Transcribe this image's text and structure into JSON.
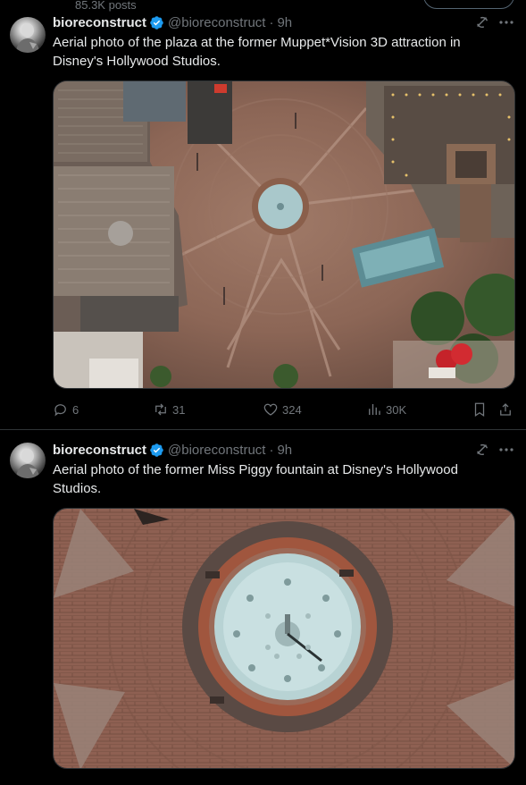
{
  "profile": {
    "posts_count": "85.3K posts"
  },
  "tweets": [
    {
      "author_name": "bioreconstruct",
      "handle": "@bioreconstruct",
      "separator": "·",
      "time": "9h",
      "text": "Aerial photo of the plaza at the former Muppet*Vision 3D attraction in Disney's Hollywood Studios.",
      "image_alt": "Aerial view of a brick plaza with a central fountain",
      "stats": {
        "replies": "6",
        "reposts": "31",
        "likes": "324",
        "views": "30K"
      }
    },
    {
      "author_name": "bioreconstruct",
      "handle": "@bioreconstruct",
      "separator": "·",
      "time": "9h",
      "text": "Aerial photo of the former Miss Piggy fountain at Disney's Hollywood Studios.",
      "image_alt": "Top-down view of a round fountain surrounded by brick paving"
    }
  ],
  "colors": {
    "background": "#000000",
    "text": "#e7e9ea",
    "secondary": "#71767b",
    "verified": "#1d9bf0",
    "border": "#2f3336"
  },
  "icons": [
    "verified-badge-icon",
    "grok-icon",
    "more-icon",
    "reply-icon",
    "repost-icon",
    "like-icon",
    "views-icon",
    "bookmark-icon",
    "share-icon"
  ]
}
